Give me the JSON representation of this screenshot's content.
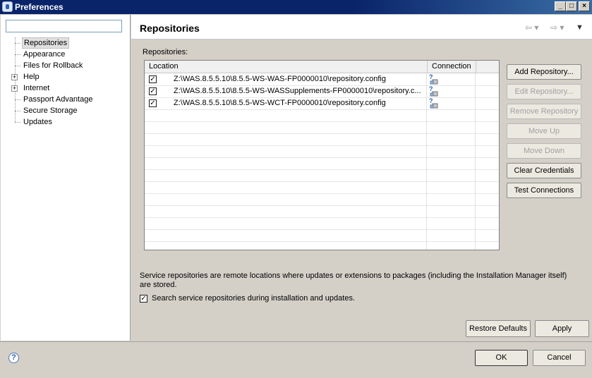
{
  "window": {
    "title": "Preferences",
    "controls": [
      "minimize",
      "maximize",
      "close"
    ]
  },
  "filter": {
    "value": "",
    "placeholder": ""
  },
  "tree": {
    "items": [
      {
        "label": "Repositories",
        "expandable": false,
        "selected": true
      },
      {
        "label": "Appearance",
        "expandable": false
      },
      {
        "label": "Files for Rollback",
        "expandable": false
      },
      {
        "label": "Help",
        "expandable": true
      },
      {
        "label": "Internet",
        "expandable": true
      },
      {
        "label": "Passport Advantage",
        "expandable": false
      },
      {
        "label": "Secure Storage",
        "expandable": false
      },
      {
        "label": "Updates",
        "expandable": false
      }
    ]
  },
  "page": {
    "title": "Repositories",
    "section_label": "Repositories:",
    "table": {
      "columns": [
        "Location",
        "Connection"
      ],
      "rows": [
        {
          "checked": true,
          "location": "Z:\\WAS.8.5.5.10\\8.5.5-WS-WAS-FP0000010\\repository.config",
          "connection_icon": "connection-unknown-icon"
        },
        {
          "checked": true,
          "location": "Z:\\WAS.8.5.5.10\\8.5.5-WS-WASSupplements-FP0000010\\repository.c...",
          "connection_icon": "connection-unknown-icon"
        },
        {
          "checked": true,
          "location": "Z:\\WAS.8.5.5.10\\8.5.5-WS-WCT-FP0000010\\repository.config",
          "connection_icon": "connection-unknown-icon"
        }
      ]
    },
    "buttons": {
      "add": "Add Repository...",
      "edit": "Edit Repository...",
      "remove": "Remove Repository",
      "move_up": "Move Up",
      "move_down": "Move Down",
      "clear_credentials": "Clear Credentials",
      "test_connections": "Test Connections"
    },
    "description": "Service repositories are remote locations where updates or extensions to packages (including the Installation Manager itself) are stored.",
    "search_service": {
      "checked": true,
      "label": "Search service repositories during installation and updates."
    },
    "restore_defaults": "Restore Defaults",
    "apply": "Apply"
  },
  "footer": {
    "ok": "OK",
    "cancel": "Cancel"
  },
  "colors": {
    "title_bar": "#0a246a",
    "dialog_bg": "#d4d0c8",
    "disabled_text": "#a0a0a0"
  }
}
